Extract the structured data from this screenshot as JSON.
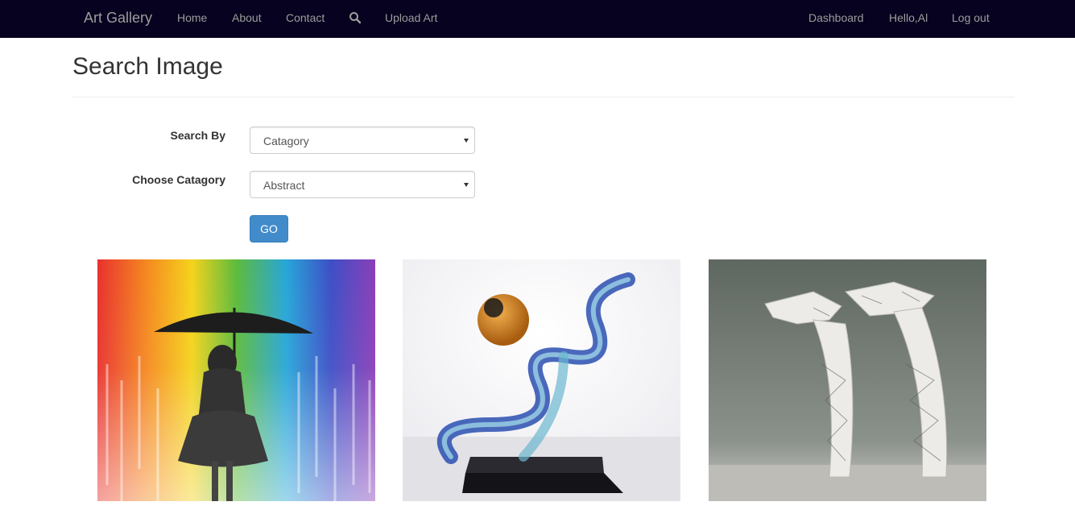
{
  "navbar": {
    "brand": "Art Gallery",
    "links": [
      "Home",
      "About",
      "Contact",
      "Upload Art"
    ],
    "search_icon": "search-icon",
    "right_links": [
      "Dashboard",
      "Hello,Al",
      "Log out"
    ],
    "background": "#06021f"
  },
  "page": {
    "title": "Search Image"
  },
  "form": {
    "search_by_label": "Search By",
    "search_by_value": "Catagory",
    "category_label": "Choose Catagory",
    "category_value": "Abstract",
    "go_label": "GO",
    "button_color": "#428bca"
  },
  "gallery": {
    "images": [
      {
        "subject": "rainbow-drip-painting-umbrella-girl"
      },
      {
        "subject": "glass-sculpture"
      },
      {
        "subject": "paper-hands-sculpture"
      }
    ]
  }
}
